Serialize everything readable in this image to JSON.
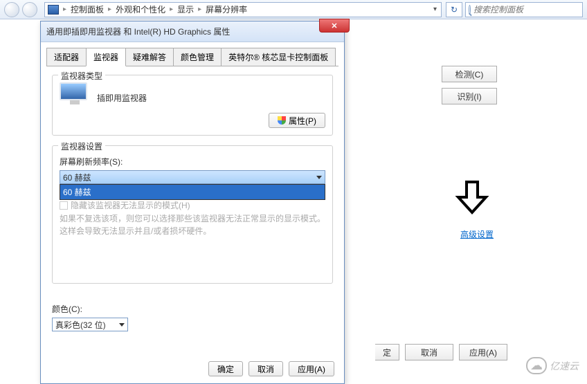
{
  "nav": {
    "crumbs": [
      "控制面板",
      "外观和个性化",
      "显示",
      "屏幕分辨率"
    ],
    "search_placeholder": "搜索控制面板",
    "refresh_glyph": "↻"
  },
  "bg": {
    "detect": "检测(C)",
    "identify": "识别(I)",
    "advanced": "高级设置",
    "ok_half": "定",
    "cancel": "取消",
    "apply": "应用(A)"
  },
  "dialog": {
    "title": "通用即插即用监视器 和 Intel(R) HD Graphics 属性",
    "close": "✕",
    "tabs": [
      "适配器",
      "监视器",
      "疑难解答",
      "颜色管理",
      "英特尔® 核芯显卡控制面板"
    ],
    "active_tab": 1,
    "monitor_type_label": "监视器类型",
    "monitor_name": "插即用监视器",
    "properties_btn": "属性(P)",
    "settings_label": "监视器设置",
    "refresh_label": "屏幕刷新频率(S):",
    "refresh_value": "60 赫兹",
    "refresh_options": [
      "60 赫兹"
    ],
    "hide_modes": "隐藏该监视器无法显示的模式(H)",
    "hide_help": "如果不复选该项，则您可以选择那些该监视器无法正常显示的显示模式。这样会导致无法显示并且/或者损坏硬件。",
    "color_label": "颜色(C):",
    "color_value": "真彩色(32 位)",
    "ok": "确定",
    "cancel": "取消",
    "apply": "应用(A)"
  },
  "watermark": {
    "text": "亿速云",
    "cloud": "☁"
  }
}
